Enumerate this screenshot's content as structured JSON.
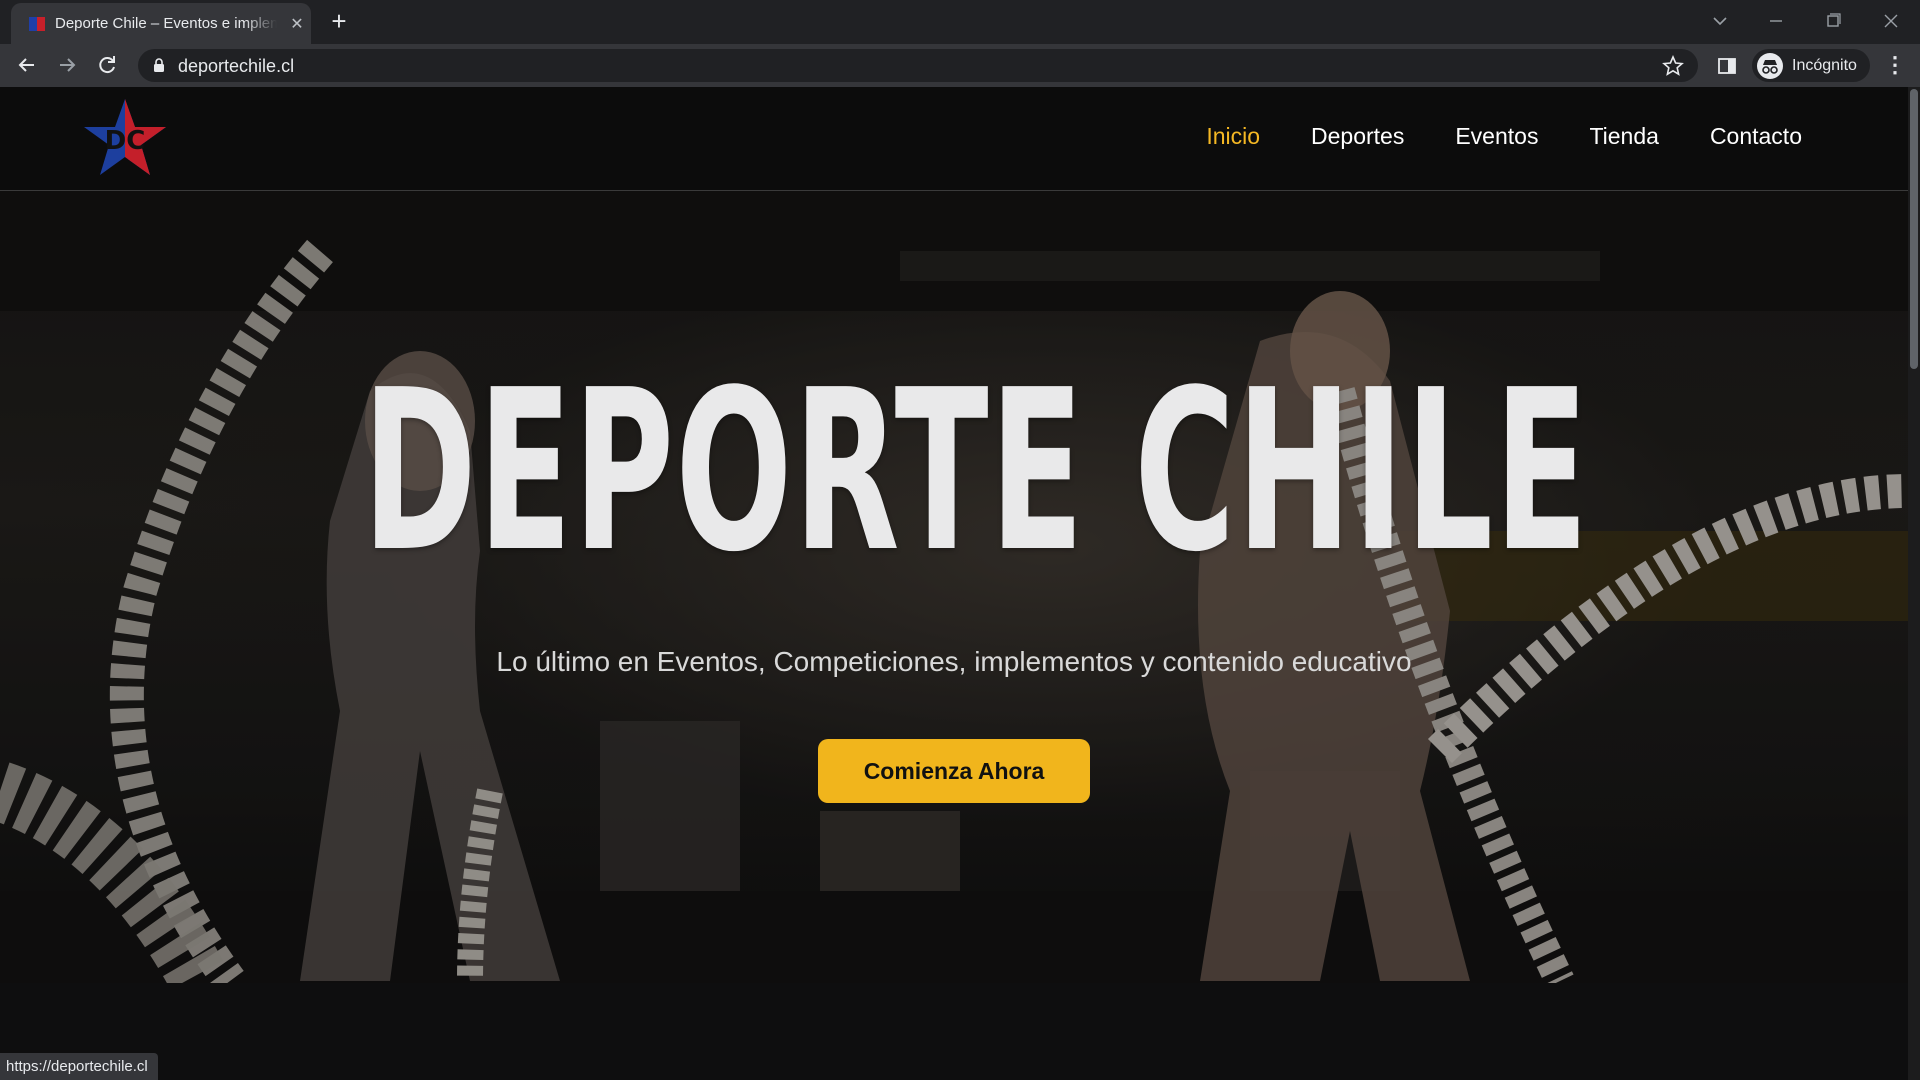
{
  "browser": {
    "tab_title": "Deporte Chile – Eventos e implementos",
    "url": "deportechile.cl",
    "profile_label": "Incógnito",
    "status_url": "https://deportechile.cl"
  },
  "site": {
    "logo_text": "DC",
    "nav": [
      {
        "label": "Inicio",
        "active": true
      },
      {
        "label": "Deportes",
        "active": false
      },
      {
        "label": "Eventos",
        "active": false
      },
      {
        "label": "Tienda",
        "active": false
      },
      {
        "label": "Contacto",
        "active": false
      }
    ]
  },
  "hero": {
    "title": "DEPORTE CHILE",
    "subtitle": "Lo último en Eventos, Competiciones, implementos y contenido educativo",
    "cta_label": "Comienza Ahora"
  },
  "colors": {
    "accent": "#f1b51c",
    "active_nav": "#f5b824",
    "header_bg": "#0c0c0c",
    "chrome_bg": "#202124"
  },
  "icons": [
    "back-icon",
    "forward-icon",
    "reload-icon",
    "lock-icon",
    "star-icon",
    "side-panel-icon",
    "incognito-icon",
    "menu-icon",
    "close-icon",
    "new-tab-icon"
  ]
}
